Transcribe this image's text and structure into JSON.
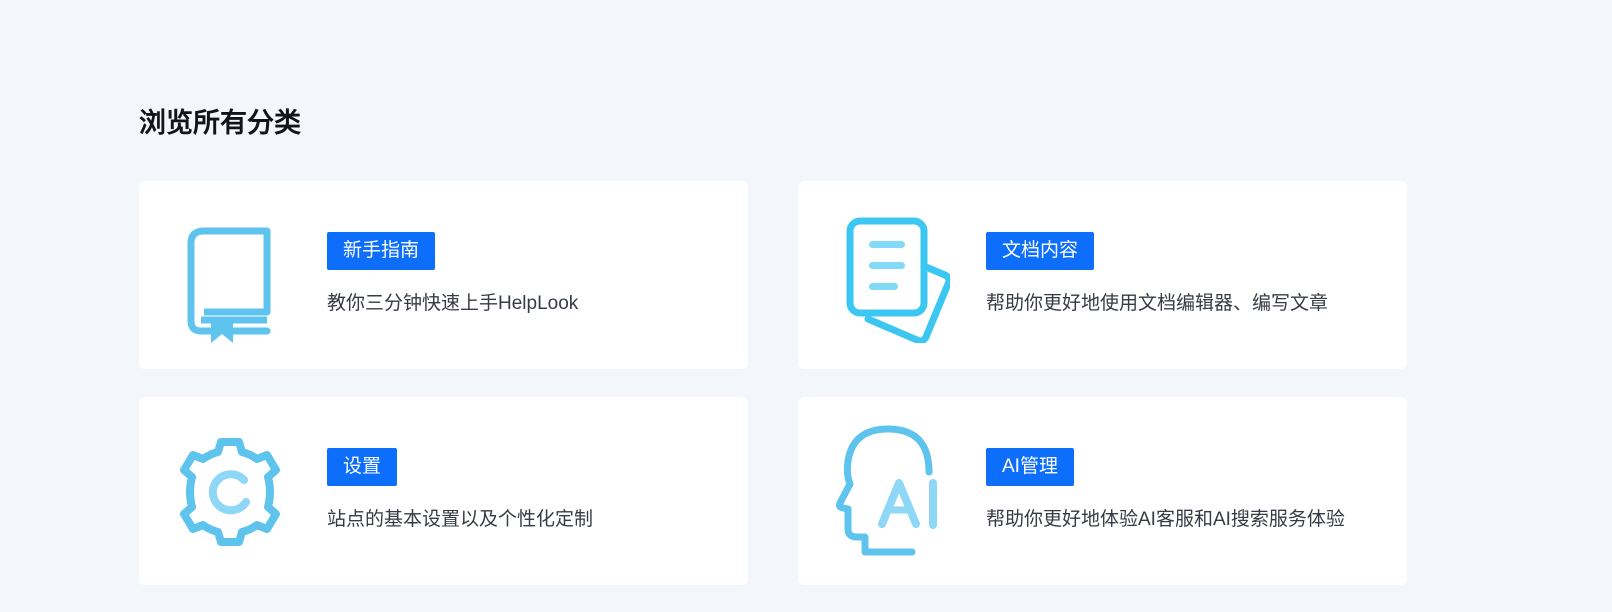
{
  "page": {
    "title": "浏览所有分类"
  },
  "categories": [
    {
      "label": "新手指南",
      "description": "教你三分钟快速上手HelpLook",
      "icon": "book-icon"
    },
    {
      "label": "文档内容",
      "description": "帮助你更好地使用文档编辑器、编写文章",
      "icon": "document-icon"
    },
    {
      "label": "设置",
      "description": "站点的基本设置以及个性化定制",
      "icon": "gear-icon"
    },
    {
      "label": "AI管理",
      "description": "帮助你更好地体验AI客服和AI搜索服务体验",
      "icon": "ai-head-icon"
    }
  ],
  "colors": {
    "background": "#f3f6fa",
    "card": "#ffffff",
    "badge": "#0c6efb",
    "icon_primary": "#5ec4ee",
    "icon_light": "#8fd7f6",
    "doc_icon": "#3cc7f3"
  }
}
